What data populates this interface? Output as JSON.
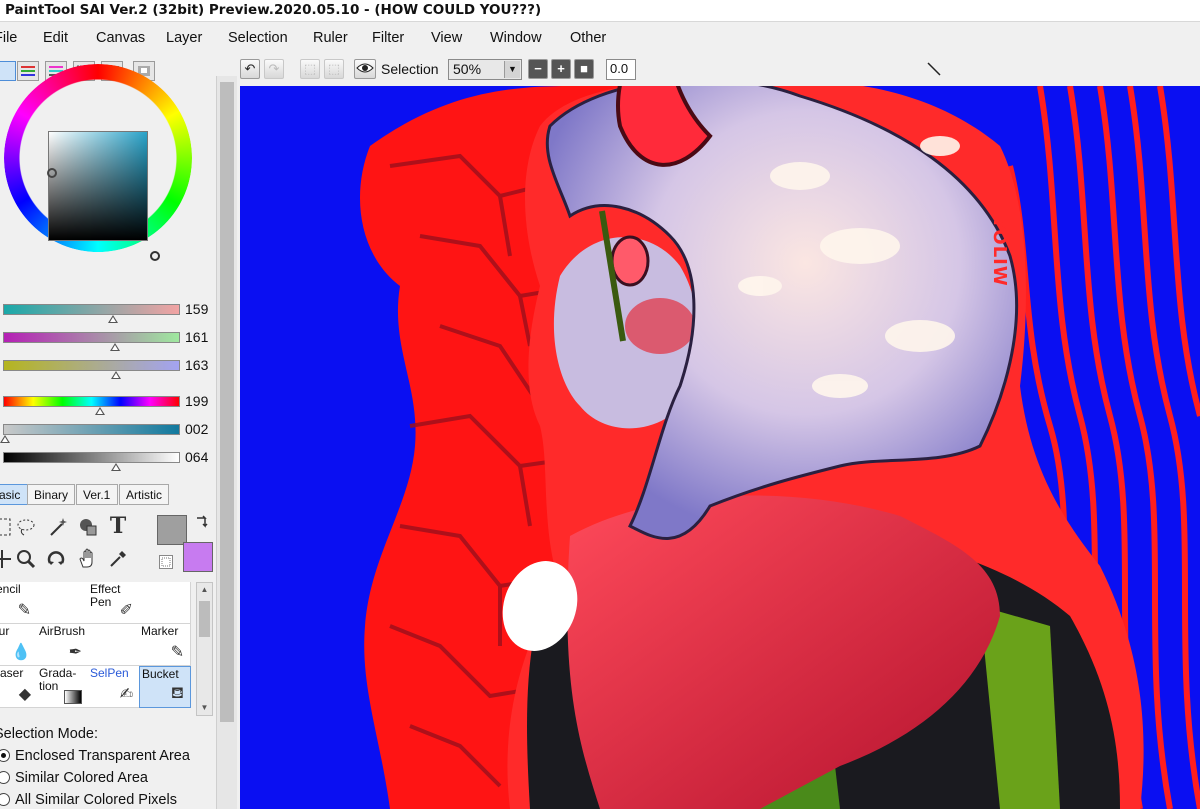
{
  "window": {
    "title": "PaintTool SAI Ver.2 (32bit) Preview.2020.05.10 - (HOW COULD YOU???)"
  },
  "menu": [
    {
      "label": "File",
      "u": "F"
    },
    {
      "label": "Edit",
      "u": "E"
    },
    {
      "label": "Canvas",
      "u": "C"
    },
    {
      "label": "Layer",
      "u": "L"
    },
    {
      "label": "Selection",
      "u": "S"
    },
    {
      "label": "Ruler",
      "u": "R"
    },
    {
      "label": "Filter",
      "u": "t"
    },
    {
      "label": "View",
      "u": "V"
    },
    {
      "label": "Window",
      "u": "W"
    },
    {
      "label": "Other",
      "u": "O"
    }
  ],
  "canvas_toolbar": {
    "selection_label": "Selection",
    "zoom": "50%",
    "angle": "0.0"
  },
  "color_sliders": [
    {
      "name": "r",
      "value": "159",
      "level": 0.62,
      "from": "#1aa9a9",
      "to": "#f2a3a3"
    },
    {
      "name": "g",
      "value": "161",
      "level": 0.63,
      "from": "#b51fb5",
      "to": "#9fe89f"
    },
    {
      "name": "b",
      "value": "163",
      "level": 0.64,
      "from": "#b5b51f",
      "to": "#a3a3f2"
    },
    {
      "name": "h",
      "value": "199",
      "level": 0.55,
      "from": "rainbow",
      "to": "rainbow"
    },
    {
      "name": "s",
      "value": "002",
      "level": 0.01,
      "from": "#c9c9c9",
      "to": "#11799e"
    },
    {
      "name": "v",
      "value": "064",
      "level": 0.64,
      "from": "#000000",
      "to": "#ffffff"
    }
  ],
  "tool_tabs": [
    {
      "label": "Basic",
      "selected": true
    },
    {
      "label": "Binary",
      "selected": false
    },
    {
      "label": "Ver.1",
      "selected": false
    },
    {
      "label": "Artistic",
      "selected": false
    }
  ],
  "colors": {
    "primary": "#9f9f9f",
    "secondary": "#c77bf0",
    "canvas_bg": "#0a0ff2",
    "accent_red": "#ff1a1a"
  },
  "brushes": [
    {
      "label": "Pencil",
      "icon": "pencil-icon",
      "selected": false
    },
    {
      "label": "",
      "icon": "",
      "selected": false
    },
    {
      "label": "Effect\nPen",
      "icon": "effect-pen-icon",
      "selected": false
    },
    {
      "label": "",
      "icon": "",
      "selected": false
    },
    {
      "label": "Blur",
      "icon": "drop-icon",
      "selected": false
    },
    {
      "label": "AirBrush",
      "icon": "airbrush-icon",
      "selected": false
    },
    {
      "label": "",
      "icon": "",
      "selected": false
    },
    {
      "label": "Marker",
      "icon": "marker-icon",
      "selected": false
    },
    {
      "label": "Eraser",
      "icon": "eraser-icon",
      "selected": false
    },
    {
      "label": "Grada-\ntion",
      "icon": "gradient-icon",
      "selected": false
    },
    {
      "label": "SelPen",
      "icon": "selpen-icon",
      "selected": false
    },
    {
      "label": "Bucket",
      "icon": "bucket-icon",
      "selected": true
    }
  ],
  "selection_mode": {
    "label": "Selection Mode:",
    "options": [
      {
        "label": "Enclosed Transparent Area",
        "checked": true
      },
      {
        "label": "Similar Colored Area",
        "checked": false
      },
      {
        "label": "All Similar Colored Pixels",
        "checked": false
      }
    ]
  },
  "artwork": {
    "signature": "YOLIW"
  }
}
